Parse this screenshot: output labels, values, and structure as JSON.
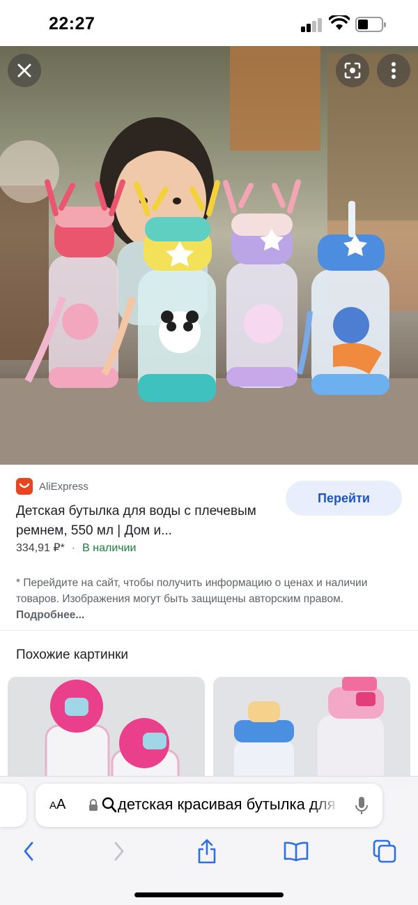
{
  "status_bar": {
    "time": "22:27",
    "battery_level": 0.45
  },
  "hero": {
    "close_icon": "close-icon",
    "lens_icon": "lens-icon",
    "more_icon": "more-vertical-icon"
  },
  "result": {
    "source": "AliExpress",
    "title": "Детская бутылка для воды с плечевым ремнем, 550 мл | Дом и...",
    "price": "334,91 ₽*",
    "dot": "·",
    "stock": "В наличии",
    "go_button": "Перейти",
    "disclaimer": "* Перейдите на сайт, чтобы получить информацию о ценах и наличии товаров. Изображения могут быть защищены авторским правом.",
    "more_link": "Подробнее..."
  },
  "similar": {
    "title": "Похожие картинки"
  },
  "browser": {
    "aa_small": "A",
    "aa_big": "A",
    "url": "детская красивая бутылка для воды",
    "icons": [
      "back-icon",
      "forward-icon",
      "share-icon",
      "bookmarks-icon",
      "tabs-icon",
      "microphone-icon",
      "lock-icon",
      "search-icon"
    ]
  },
  "colors": {
    "accent": "#1a56c4",
    "stock_green": "#188038",
    "source_logo": "#e8451e",
    "button_bg": "#e8eefb"
  }
}
